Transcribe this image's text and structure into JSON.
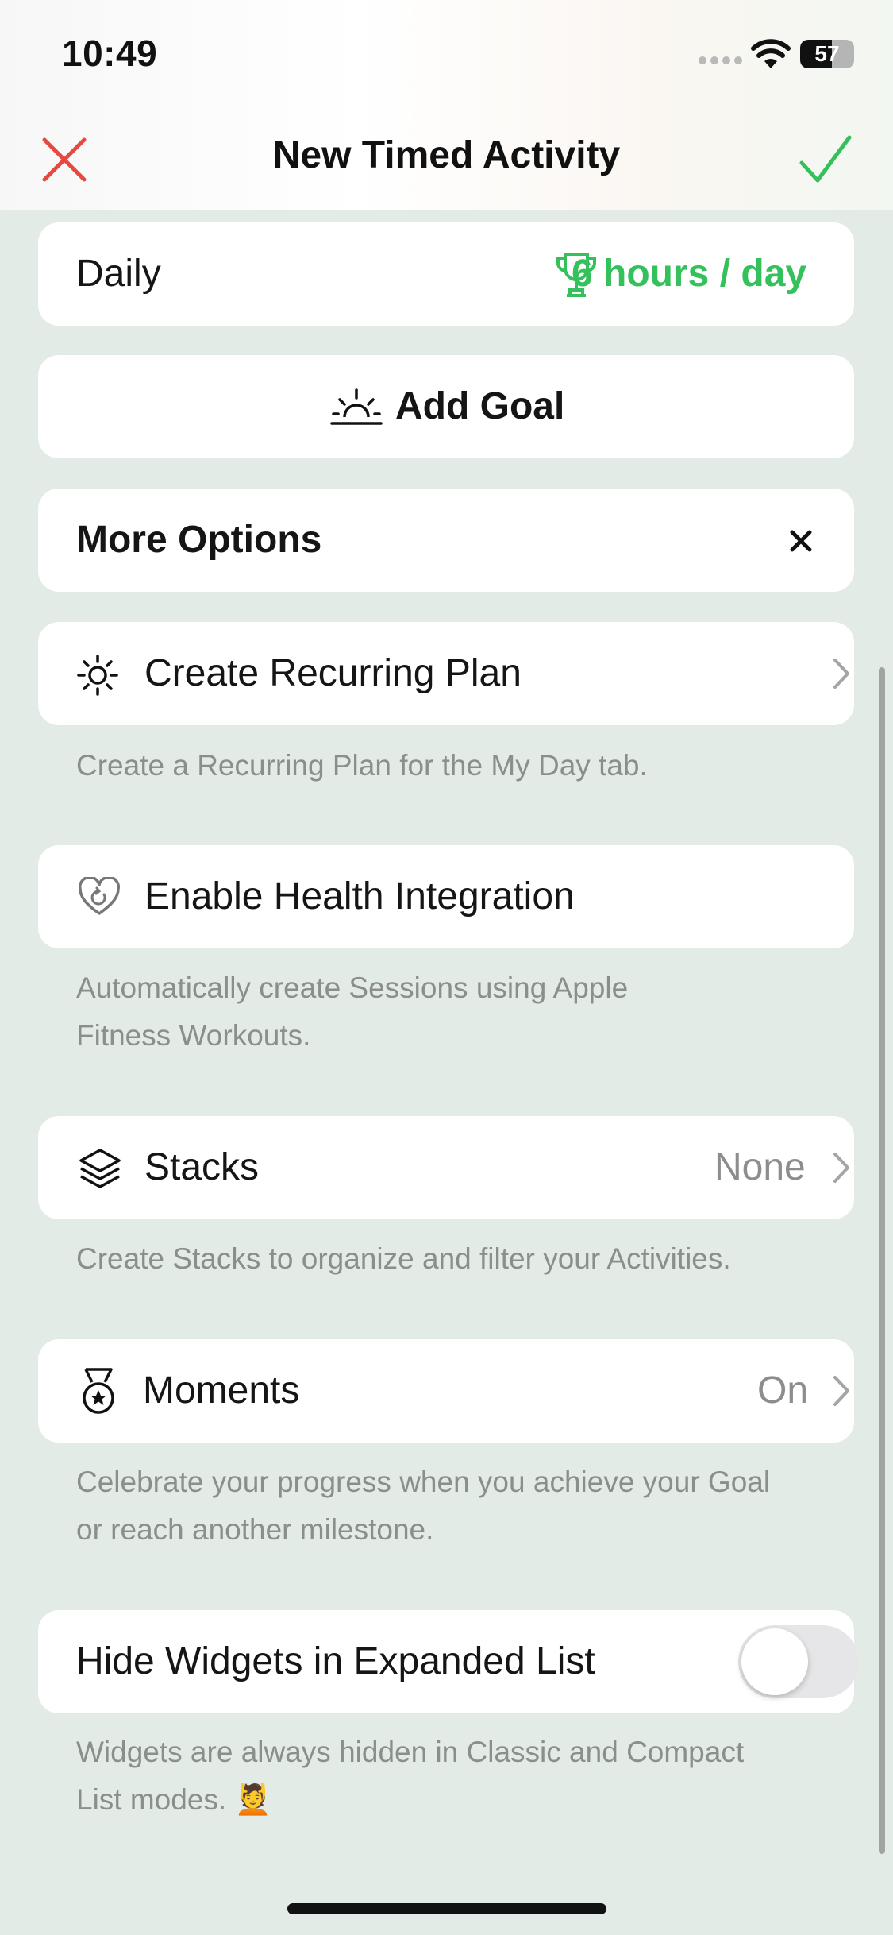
{
  "status_bar": {
    "time": "10:49",
    "battery": "57"
  },
  "nav": {
    "title": "New Timed Activity"
  },
  "goal_card": {
    "label": "Daily",
    "goal_value": "6 hours / day"
  },
  "add_goal": {
    "label": "Add Goal"
  },
  "more_options": {
    "label": "More Options"
  },
  "recurring_plan": {
    "label": "Create Recurring Plan",
    "footer": "Create a Recurring Plan for the My Day tab."
  },
  "health": {
    "label": "Enable Health Integration",
    "footer_line1": "Automatically create Sessions using Apple",
    "footer_line2": "Fitness Workouts."
  },
  "stacks": {
    "label": "Stacks",
    "value": "None",
    "footer": "Create Stacks to organize and filter your Activities."
  },
  "moments": {
    "label": "Moments",
    "value": "On",
    "footer_line1": "Celebrate your progress when you achieve your Goal",
    "footer_line2": "or reach another milestone."
  },
  "widgets": {
    "label": "Hide Widgets in Expanded List",
    "toggle_on": false,
    "footer_line1": "Widgets are always hidden in Classic and Compact",
    "footer_line2": "List modes. 💆"
  },
  "colors": {
    "accent_green": "#34c05a",
    "cancel_red": "#e8483f",
    "background": "#e3ebe6"
  }
}
